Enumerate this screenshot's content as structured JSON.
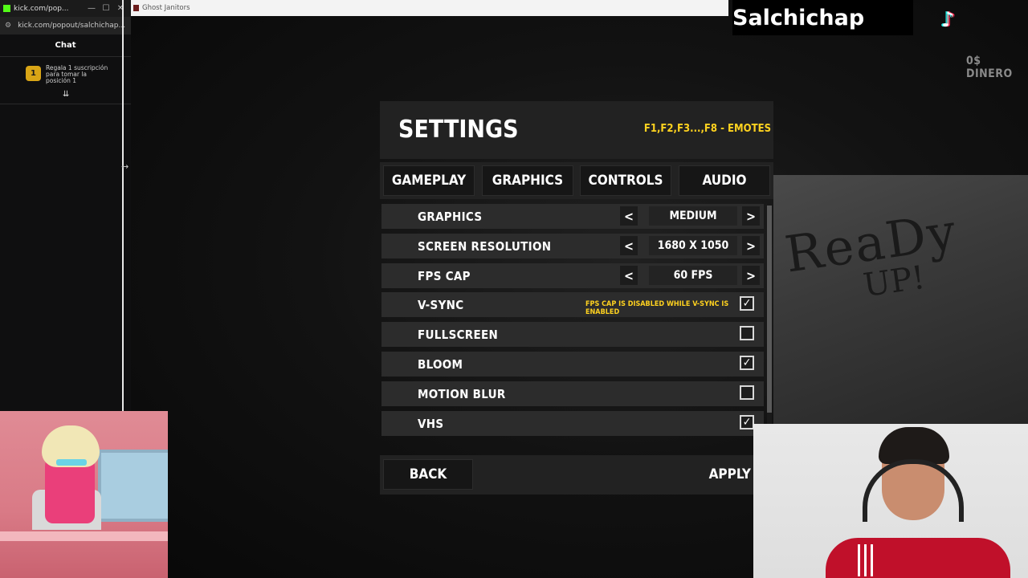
{
  "popout": {
    "window_title": "kick.com/pop...",
    "url": "kick.com/popout/salchichap...",
    "chat_header": "Chat",
    "pinned": {
      "rank": "1",
      "text": "Regala 1 suscripción para tomar la posición 1"
    }
  },
  "game": {
    "window_title": "Ghost Janitors",
    "money": "0$  DINERO",
    "overlay_name": "Salchichap"
  },
  "settings": {
    "title": "SETTINGS",
    "emotes_hint": "F1,F2,F3...,F8 - EMOTES",
    "tabs": [
      "GAMEPLAY",
      "GRAPHICS",
      "CONTROLS",
      "AUDIO"
    ],
    "rows": [
      {
        "label": "GRAPHICS",
        "type": "select",
        "value": "MEDIUM"
      },
      {
        "label": "SCREEN RESOLUTION",
        "type": "select",
        "value": "1680 X 1050"
      },
      {
        "label": "FPS CAP",
        "type": "select",
        "value": "60 FPS"
      },
      {
        "label": "V-SYNC",
        "type": "checkbox",
        "checked": true,
        "note": "FPS CAP IS DISABLED WHILE V-SYNC IS ENABLED"
      },
      {
        "label": "FULLSCREEN",
        "type": "checkbox",
        "checked": false
      },
      {
        "label": "BLOOM",
        "type": "checkbox",
        "checked": true
      },
      {
        "label": "MOTION BLUR",
        "type": "checkbox",
        "checked": false
      },
      {
        "label": "VHS",
        "type": "checkbox",
        "checked": true
      }
    ],
    "arrow_left": "<",
    "arrow_right": ">",
    "back": "BACK",
    "apply": "APPLY"
  },
  "board_text": {
    "line1": "ReaDy",
    "line2": "UP!"
  },
  "colors": {
    "accent_yellow": "#ffd21f",
    "kick_green": "#53fc18"
  }
}
